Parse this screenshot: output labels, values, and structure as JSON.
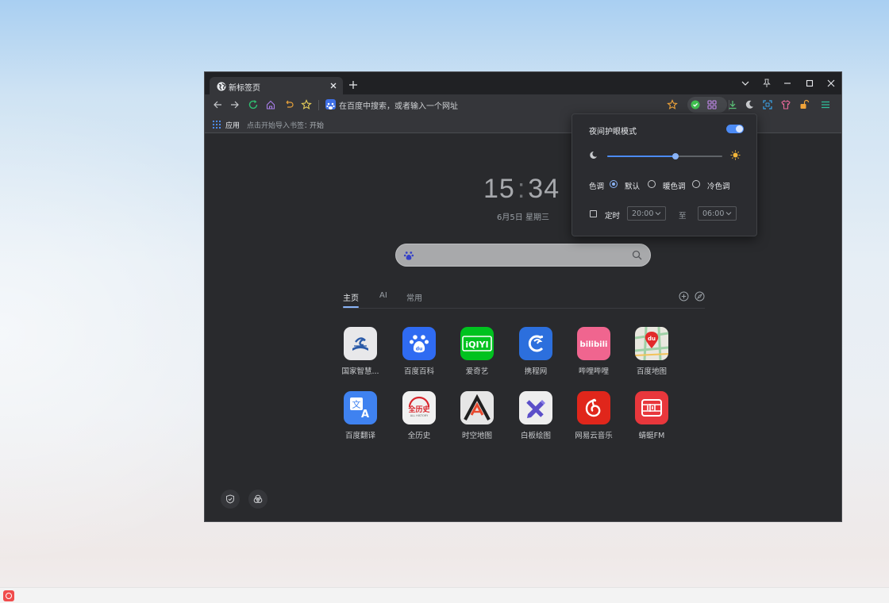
{
  "browser": {
    "tab": {
      "title": "新标签页"
    },
    "omnibox": {
      "placeholder": "在百度中搜索，或者输入一个网址"
    },
    "bookmarks": {
      "apps_label": "应用",
      "hint": "点击开始导入书签：",
      "start_link": "开始"
    }
  },
  "newtab": {
    "clock": {
      "hours": "15",
      "separator": ":",
      "minutes": "34"
    },
    "date": "6月5日 星期三",
    "tabs": [
      {
        "label": "主页",
        "active": true
      },
      {
        "label": "AI",
        "active": false
      },
      {
        "label": "常用",
        "active": false
      }
    ],
    "tiles": [
      {
        "label": "国家智慧...",
        "icon": "book-wave-icon",
        "bg": "#e8e8ea"
      },
      {
        "label": "百度百科",
        "icon": "baidu-paw-icon",
        "bg": "#2f6bf2"
      },
      {
        "label": "爱奇艺",
        "icon": "iqiyi-icon",
        "bg": "#00c21f"
      },
      {
        "label": "携程网",
        "icon": "dolphin-icon",
        "bg": "#2c6fdd"
      },
      {
        "label": "哔哩哔哩",
        "icon": "bilibili-icon",
        "bg": "#f0658f"
      },
      {
        "label": "百度地图",
        "icon": "map-pin-icon",
        "bg": "#e9e7df"
      },
      {
        "label": "百度翻译",
        "icon": "translate-icon",
        "bg": "#3f82f0"
      },
      {
        "label": "全历史",
        "icon": "history-icon",
        "bg": "#f1f1f1"
      },
      {
        "label": "时空地图",
        "icon": "mountain-a-icon",
        "bg": "#e6e6e6"
      },
      {
        "label": "白板绘图",
        "icon": "pencil-ruler-icon",
        "bg": "#eeeeee"
      },
      {
        "label": "网易云音乐",
        "icon": "netease-music-icon",
        "bg": "#e0261b"
      },
      {
        "label": "蜻蜓FM",
        "icon": "radio-fm-icon",
        "bg": "#e8373c"
      }
    ],
    "tile_text": {
      "iqiyi": "iQIYI",
      "bilibili": "bilibili",
      "translate_zh": "文",
      "translate_en": "A",
      "history": "全历史",
      "history_sub": "ALL HISTORY",
      "map_du": "du",
      "paw_du": "du"
    }
  },
  "popup": {
    "title": "夜间护眼模式",
    "enabled": true,
    "brightness": 0.59,
    "tone_label": "色调",
    "tones": [
      {
        "label": "默认",
        "selected": true
      },
      {
        "label": "暖色调",
        "selected": false
      },
      {
        "label": "冷色调",
        "selected": false
      }
    ],
    "schedule_label": "定时",
    "schedule_enabled": false,
    "from": "20:00",
    "to_label": "至",
    "to": "06:00"
  },
  "colors": {
    "accent": "#8ab4f8",
    "toggle": "#4c8bf5",
    "window_bg": "#292a2d",
    "toolbar_bg": "#35363a"
  }
}
